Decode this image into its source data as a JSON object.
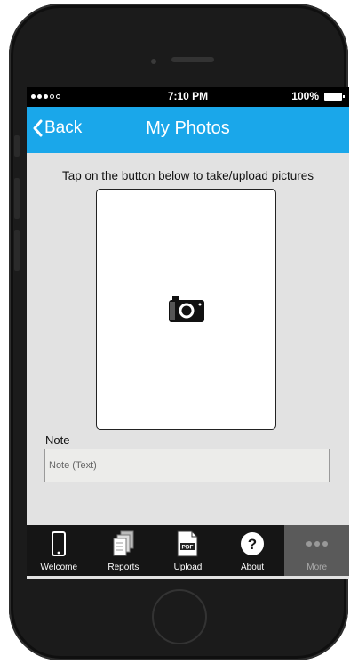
{
  "status_bar": {
    "time": "7:10 PM",
    "battery": "100%"
  },
  "nav": {
    "back_label": "Back",
    "title": "My Photos"
  },
  "main": {
    "instruction": "Tap on the button below to take/upload pictures",
    "note_label": "Note",
    "note_placeholder": "Note (Text)"
  },
  "tabs": [
    {
      "label": "Welcome",
      "icon": "phone-icon"
    },
    {
      "label": "Reports",
      "icon": "documents-icon"
    },
    {
      "label": "Upload",
      "icon": "pdf-icon"
    },
    {
      "label": "About",
      "icon": "question-icon"
    },
    {
      "label": "More",
      "icon": "more-dots-icon"
    }
  ],
  "colors": {
    "accent": "#1aa7ea",
    "tabbar": "#151515",
    "screen_bg": "#e2e2e2"
  }
}
